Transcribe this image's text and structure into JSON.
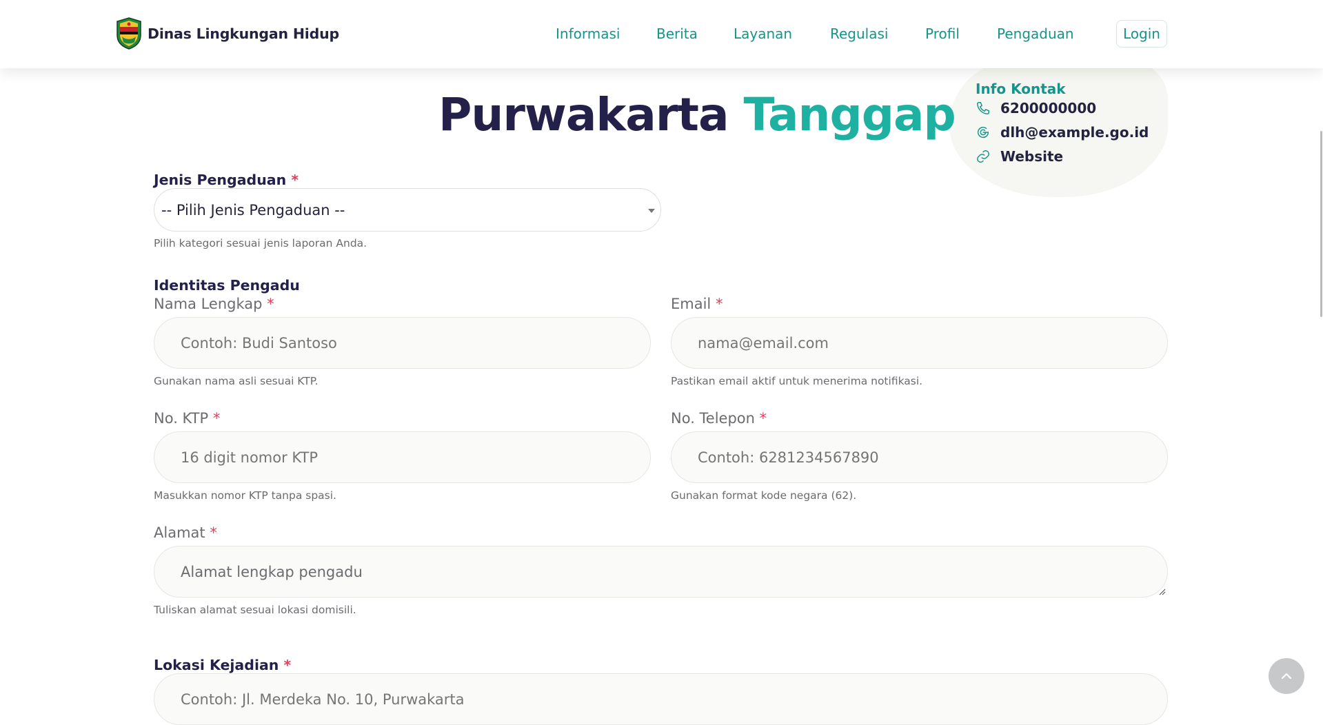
{
  "header": {
    "brand": "Dinas Lingkungan Hidup",
    "nav": [
      "Informasi",
      "Berita",
      "Layanan",
      "Regulasi",
      "Profil",
      "Pengaduan"
    ],
    "login": "Login"
  },
  "contact": {
    "title": "Info Kontak",
    "phone": "6200000000",
    "email": "dlh@example.go.id",
    "website": "Website"
  },
  "title": {
    "part1": "Purwakarta",
    "part2": "Tanggap"
  },
  "form": {
    "required_mark": "*",
    "jenis": {
      "label": "Jenis Pengaduan",
      "value": "-- Pilih Jenis Pengaduan --",
      "help": "Pilih kategori sesuai jenis laporan Anda."
    },
    "identitas_heading": "Identitas Pengadu",
    "nama": {
      "label": "Nama Lengkap",
      "placeholder": "Contoh: Budi Santoso",
      "help": "Gunakan nama asli sesuai KTP."
    },
    "email": {
      "label": "Email",
      "placeholder": "nama@email.com",
      "help": "Pastikan email aktif untuk menerima notifikasi."
    },
    "ktp": {
      "label": "No. KTP",
      "placeholder": "16 digit nomor KTP",
      "help": "Masukkan nomor KTP tanpa spasi."
    },
    "telepon": {
      "label": "No. Telepon",
      "placeholder": "Contoh: 6281234567890",
      "help": "Gunakan format kode negara (62)."
    },
    "alamat": {
      "label": "Alamat",
      "placeholder": "Alamat lengkap pengadu",
      "help": "Tuliskan alamat sesuai lokasi domisili."
    },
    "lokasi": {
      "label": "Lokasi Kejadian",
      "placeholder": "Contoh: Jl. Merdeka No. 10, Purwakarta"
    }
  },
  "colors": {
    "accent": "#1eb0a0",
    "nav": "#14958b",
    "dark": "#23204a",
    "required": "#e0405a"
  }
}
